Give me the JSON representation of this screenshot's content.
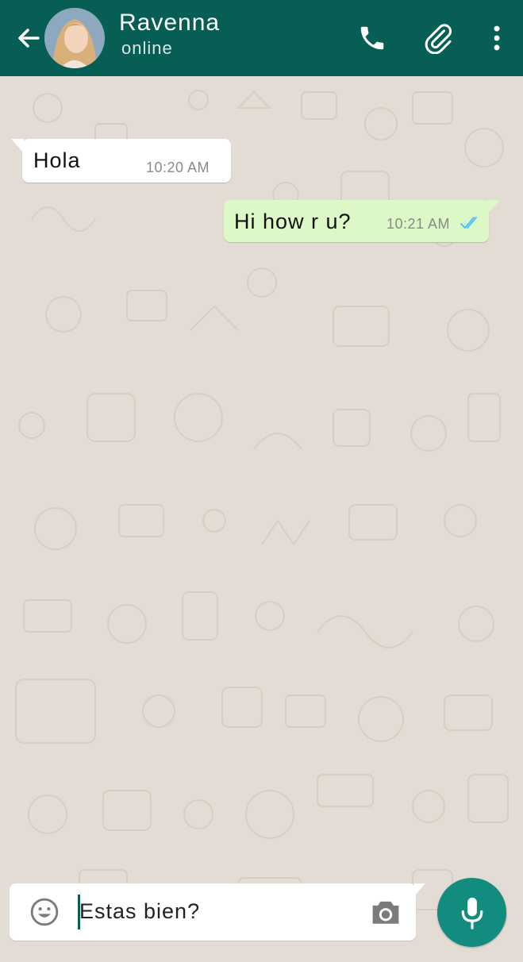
{
  "header": {
    "contact_name": "Ravenna",
    "status": "online",
    "back_icon": "arrow-left-icon",
    "call_icon": "phone-icon",
    "attach_icon": "paperclip-icon",
    "menu_icon": "more-vertical-icon"
  },
  "messages": [
    {
      "direction": "incoming",
      "text": "Hola",
      "time": "10:20 AM"
    },
    {
      "direction": "outgoing",
      "text": "Hi how r u?",
      "time": "10:21 AM",
      "read_icon": "double-check-icon"
    }
  ],
  "composer": {
    "value": "Estas bien?",
    "emoji_icon": "emoji-icon",
    "camera_icon": "camera-icon",
    "mic_icon": "microphone-icon"
  },
  "colors": {
    "header": "#075e54",
    "outgoing_bubble": "#dcf8c6",
    "incoming_bubble": "#ffffff",
    "wallpaper": "#e3dcd4",
    "mic_button": "#128c7e",
    "read_ticks": "#4fc3f7"
  }
}
